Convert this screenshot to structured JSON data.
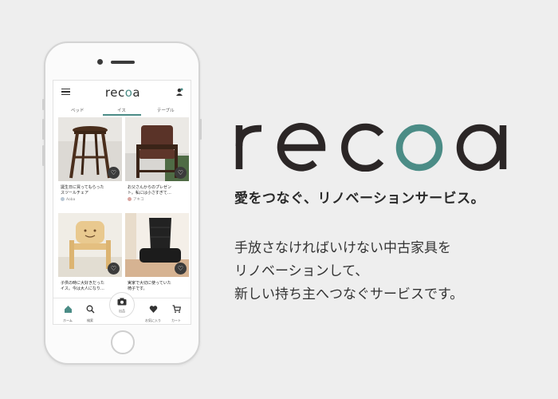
{
  "brand": {
    "name": "recoa",
    "name_prefix": "rec",
    "name_o": "o",
    "name_suffix": "a",
    "accent": "#4b8c86",
    "tagline": "愛をつなぐ、リノベーションサービス。",
    "description": [
      "手放さなければいけない中古家具を",
      "リノベーションして、",
      "新しい持ち主へつなぐサービスです。"
    ]
  },
  "app": {
    "tabs": [
      {
        "label": "ベッド"
      },
      {
        "label": "イス",
        "active": true
      },
      {
        "label": "テーブル"
      }
    ],
    "cards": [
      {
        "description_line1": "誕生日に買ってもらった",
        "description_line2": "スツールチェア",
        "user": "Aoba"
      },
      {
        "description_line1": "お父さんからのプレゼン",
        "description_line2": "ト。私には小さすぎて…",
        "user": "アキコ"
      },
      {
        "description_line1": "子供の時に大好きだった",
        "description_line2": "イス。今は大人になり…",
        "user": ""
      },
      {
        "description_line1": "実家で大切に使っていた",
        "description_line2": "椅子です。",
        "user": ""
      }
    ],
    "nav": [
      {
        "label": "ホーム",
        "icon": "home-icon"
      },
      {
        "label": "検索",
        "icon": "search-icon"
      },
      {
        "label": "出品",
        "icon": "camera-icon"
      },
      {
        "label": "お気に入り",
        "icon": "heart-icon"
      },
      {
        "label": "カート",
        "icon": "cart-icon"
      }
    ]
  }
}
